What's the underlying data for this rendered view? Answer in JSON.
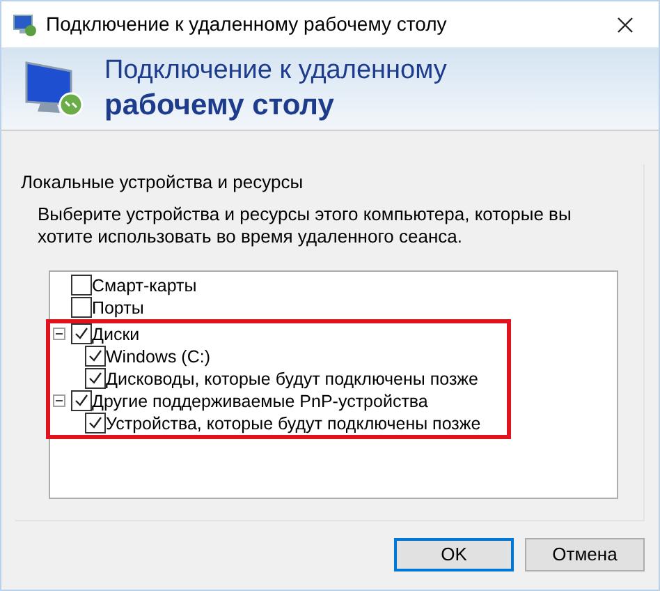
{
  "window": {
    "title": "Подключение к удаленному рабочему столу"
  },
  "header": {
    "line_1": "Подключение к удаленному",
    "line_2": "рабочему столу"
  },
  "group": {
    "title": "Локальные устройства и ресурсы",
    "description": "Выберите устройства и ресурсы этого компьютера, которые вы хотите использовать во время удаленного сеанса."
  },
  "tree": [
    {
      "label": "Смарт-карты",
      "checked": false,
      "highlighted": false
    },
    {
      "label": "Порты",
      "checked": false,
      "highlighted": false
    },
    {
      "label": "Диски",
      "checked": true,
      "highlighted": true,
      "expanded": true,
      "children": [
        {
          "label": "Windows (C:)",
          "checked": true
        },
        {
          "label": "Дисководы, которые будут подключены позже",
          "checked": true
        }
      ]
    },
    {
      "label": "Другие поддерживаемые PnP-устройства",
      "checked": true,
      "highlighted": true,
      "expanded": true,
      "children": [
        {
          "label": "Устройства, которые будут подключены позже",
          "checked": true
        }
      ]
    }
  ],
  "buttons": [
    {
      "label": "OK",
      "default": true
    },
    {
      "label": "Отмена",
      "default": false
    }
  ]
}
